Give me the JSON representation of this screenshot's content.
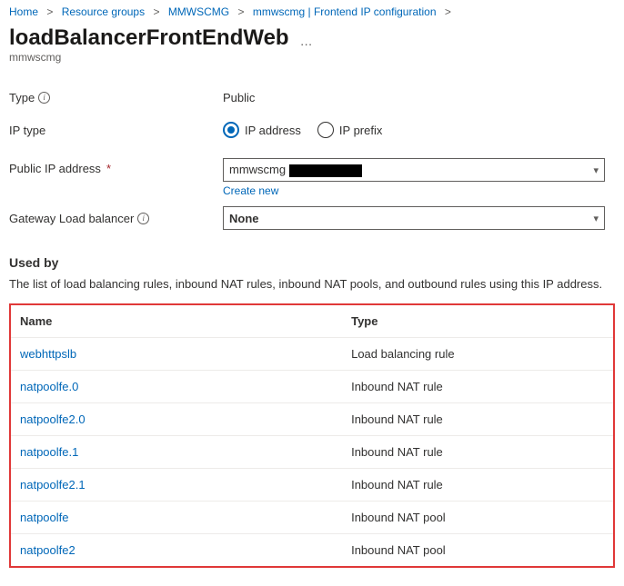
{
  "breadcrumb": {
    "items": [
      "Home",
      "Resource groups",
      "MMWSCMG",
      "mmwscmg | Frontend IP configuration"
    ]
  },
  "header": {
    "title": "loadBalancerFrontEndWeb",
    "subtitle": "mmwscmg",
    "more": "…"
  },
  "form": {
    "type_label": "Type",
    "type_value": "Public",
    "iptype_label": "IP type",
    "iptype_opt1": "IP address",
    "iptype_opt2": "IP prefix",
    "publicip_label": "Public IP address",
    "publicip_value": "mmwscmg",
    "create_new": "Create new",
    "gateway_label": "Gateway Load balancer",
    "gateway_value": "None"
  },
  "usedby": {
    "heading": "Used by",
    "description": "The list of load balancing rules, inbound NAT rules, inbound NAT pools, and outbound rules using this IP address.",
    "col_name": "Name",
    "col_type": "Type",
    "rows": [
      {
        "name": "webhttpslb",
        "type": "Load balancing rule"
      },
      {
        "name": "natpoolfe.0",
        "type": "Inbound NAT rule"
      },
      {
        "name": "natpoolfe2.0",
        "type": "Inbound NAT rule"
      },
      {
        "name": "natpoolfe.1",
        "type": "Inbound NAT rule"
      },
      {
        "name": "natpoolfe2.1",
        "type": "Inbound NAT rule"
      },
      {
        "name": "natpoolfe",
        "type": "Inbound NAT pool"
      },
      {
        "name": "natpoolfe2",
        "type": "Inbound NAT pool"
      }
    ]
  }
}
